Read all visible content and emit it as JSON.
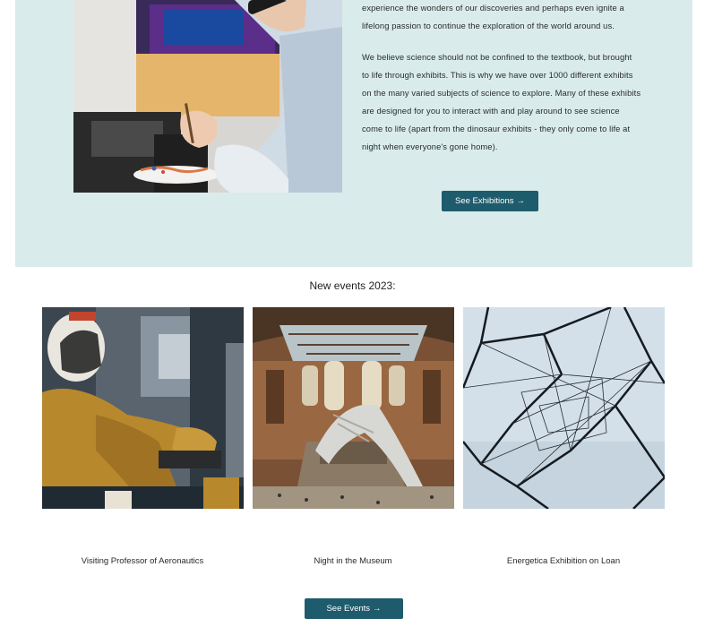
{
  "about": {
    "paragraph1": "experience the wonders of our discoveries and perhaps even ignite a lifelong passion to continue the exploration of the world around us.",
    "paragraph2": "We believe science should not be confined to the textbook, but brought to life through exhibits. This is why we have over 1000 different exhibits on the many varied subjects of science to explore. Many of these exhibits are designed for you to interact with and play around to see science come to life (apart from the dinosaur exhibits - they only come to life at night when everyone's gone home).",
    "button_label": "See Exhibitions",
    "button_arrow": "→"
  },
  "events": {
    "title": "New events 2023:",
    "items": [
      {
        "caption": "Visiting Professor of Aeronautics",
        "image": "astronaut-photo"
      },
      {
        "caption": "Night in the Museum",
        "image": "museum-hall-photo"
      },
      {
        "caption": "Energetica Exhibition on Loan",
        "image": "geometric-sculpture-photo"
      }
    ],
    "button_label": "See Events",
    "button_arrow": "→"
  },
  "colors": {
    "hero_background": "#d9eceb",
    "button": "#1e5b6d",
    "button_text": "#ffffff"
  }
}
